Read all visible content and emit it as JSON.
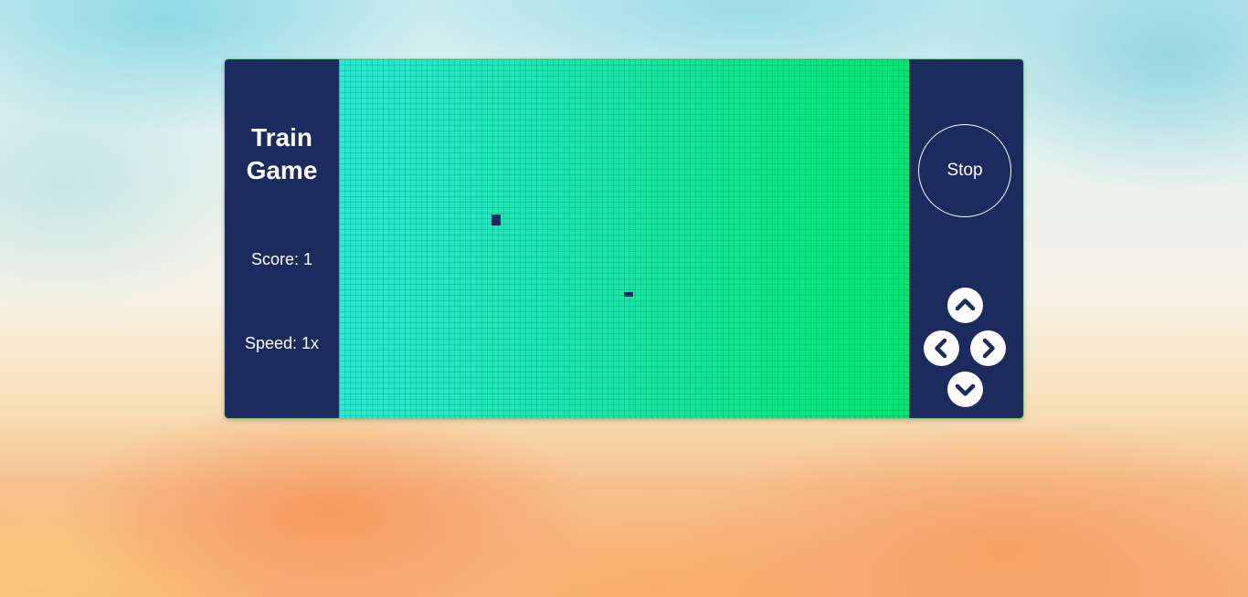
{
  "game": {
    "title_line1": "Train",
    "title_line2": "Game",
    "score_text": "Score: 1",
    "speed_text": "Speed: 1x",
    "stop_label": "Stop"
  },
  "colors": {
    "panel": "#1b2b5e",
    "board_left": "#2de8d2",
    "board_right": "#06e474",
    "button": "#ffffff"
  },
  "controls": [
    {
      "name": "up-arrow-button",
      "icon": "chevron-up-icon"
    },
    {
      "name": "left-arrow-button",
      "icon": "chevron-left-icon"
    },
    {
      "name": "right-arrow-button",
      "icon": "chevron-right-icon"
    },
    {
      "name": "down-arrow-button",
      "icon": "chevron-down-icon"
    }
  ],
  "board_pieces": [
    {
      "name": "train-head",
      "icon": "train-block"
    },
    {
      "name": "food-item",
      "icon": "food-block"
    }
  ]
}
